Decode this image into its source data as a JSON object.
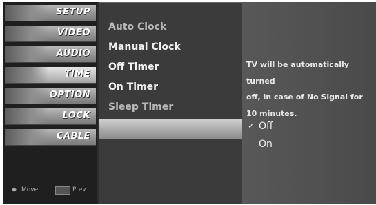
{
  "categories": [
    {
      "label": "SETUP",
      "icon": "setup-icon",
      "selected": false
    },
    {
      "label": "VIDEO",
      "icon": "video-icon",
      "selected": false
    },
    {
      "label": "AUDIO",
      "icon": "audio-icon",
      "selected": false
    },
    {
      "label": "TIME",
      "icon": "clock-icon",
      "selected": true
    },
    {
      "label": "OPTION",
      "icon": "option-icon",
      "selected": false
    },
    {
      "label": "LOCK",
      "icon": "lock-icon",
      "selected": false
    },
    {
      "label": "CABLE",
      "icon": "cable-icon",
      "selected": false
    }
  ],
  "bottom": {
    "move_label": "Move",
    "prev_label": "Prev"
  },
  "submenu": {
    "items": [
      "Auto Clock",
      "Manual Clock",
      "Off Timer",
      "On Timer",
      "Sleep Timer"
    ]
  },
  "info": {
    "description_lines": [
      "TV will be automatically turned",
      "off, in case of No Signal for",
      "10 minutes."
    ],
    "options": [
      {
        "label": "Off",
        "checked": true
      },
      {
        "label": "On",
        "checked": false
      }
    ],
    "check_mark": "✓"
  }
}
